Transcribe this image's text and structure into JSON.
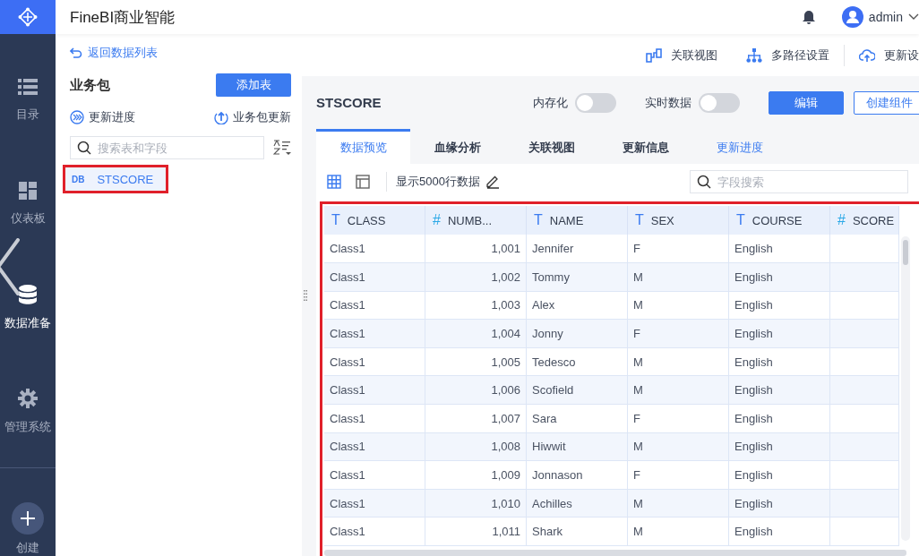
{
  "app": {
    "title": "FineBI商业智能",
    "user": "admin"
  },
  "nav": [
    {
      "label": "目录",
      "selected": false
    },
    {
      "label": "仪表板",
      "selected": false
    },
    {
      "label": "数据准备",
      "selected": true
    },
    {
      "label": "管理系统",
      "selected": false
    }
  ],
  "create": {
    "label": "创建"
  },
  "left_panel": {
    "back_link": "返回数据列表",
    "title": "业务包",
    "add_button": "添加表",
    "update_progress": "更新进度",
    "package_update": "业务包更新",
    "search": {
      "placeholder": "搜索表和字段"
    },
    "tables": [
      {
        "tag": "DB",
        "label": "STSCORE",
        "selected": true,
        "highlighted": true
      }
    ]
  },
  "toolbar": [
    {
      "label": "关联视图"
    },
    {
      "label": "多路径设置"
    },
    {
      "label": "更新设"
    }
  ],
  "table_view": {
    "title": "STSCORE",
    "toggles": [
      {
        "label": "内存化",
        "on": false
      },
      {
        "label": "实时数据",
        "on": false
      }
    ],
    "buttons": [
      {
        "label": "编辑",
        "kind": "primary"
      },
      {
        "label": "创建组件",
        "kind": "outline"
      }
    ],
    "tabs": [
      {
        "label": "数据预览",
        "kind": "tab",
        "selected": true
      },
      {
        "label": "血缘分析",
        "kind": "tab",
        "selected": false
      },
      {
        "label": "关联视图",
        "kind": "tab",
        "selected": false
      },
      {
        "label": "更新信息",
        "kind": "tab",
        "selected": false
      },
      {
        "label": "更新进度",
        "kind": "link",
        "selected": false
      }
    ],
    "view_modes": [
      {
        "selected": true
      },
      {
        "selected": false
      }
    ],
    "row_limit": "显示5000行数据",
    "field_search": {
      "placeholder": "字段搜索"
    },
    "highlighted": true,
    "table": {
      "columns": [
        {
          "mark": "T",
          "name": "CLASS",
          "kind": "text"
        },
        {
          "mark": "#",
          "name": "NUMB...",
          "kind": "number"
        },
        {
          "mark": "T",
          "name": "NAME",
          "kind": "text"
        },
        {
          "mark": "T",
          "name": "SEX",
          "kind": "text"
        },
        {
          "mark": "T",
          "name": "COURSE",
          "kind": "text"
        },
        {
          "mark": "#",
          "name": "SCORE",
          "kind": "number"
        }
      ],
      "rows": [
        [
          "Class1",
          "1,001",
          "Jennifer",
          "F",
          "English"
        ],
        [
          "Class1",
          "1,002",
          "Tommy",
          "M",
          "English"
        ],
        [
          "Class1",
          "1,003",
          "Alex",
          "M",
          "English"
        ],
        [
          "Class1",
          "1,004",
          "Jonny",
          "F",
          "English"
        ],
        [
          "Class1",
          "1,005",
          "Tedesco",
          "M",
          "English"
        ],
        [
          "Class1",
          "1,006",
          "Scofield",
          "M",
          "English"
        ],
        [
          "Class1",
          "1,007",
          "Sara",
          "F",
          "English"
        ],
        [
          "Class1",
          "1,008",
          "Hiwwit",
          "M",
          "English"
        ],
        [
          "Class1",
          "1,009",
          "Jonnason",
          "F",
          "English"
        ],
        [
          "Class1",
          "1,010",
          "Achilles",
          "M",
          "English"
        ],
        [
          "Class1",
          "1,011",
          "Shark",
          "M",
          "English"
        ]
      ]
    }
  }
}
